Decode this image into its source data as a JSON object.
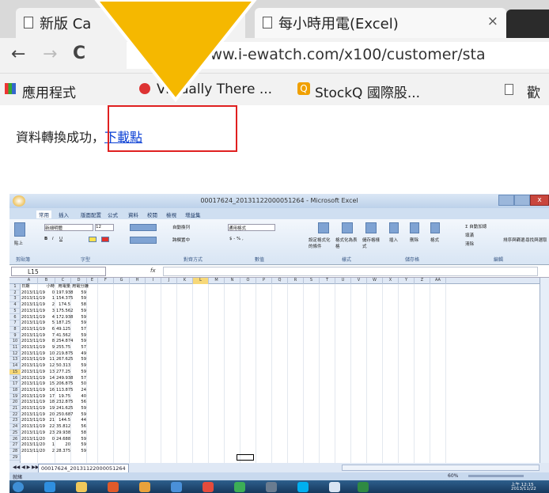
{
  "browser": {
    "tabs": [
      {
        "label": "新版 Ca",
        "active": false
      },
      {
        "label": "每小時用電(Excel)",
        "active": true
      }
    ],
    "address": "www.i-ewatch.com/x100/customer/sta",
    "bookmarks": [
      "應用程式",
      "Virtually There ...",
      "StockQ 國際股...",
      "歡"
    ]
  },
  "page": {
    "message": "資料轉換成功，",
    "download_link": "下載點"
  },
  "excel": {
    "window_title": "00017624_20131122000051264 - Microsoft Excel",
    "menu": [
      "常用",
      "插入",
      "版面配置",
      "公式",
      "資料",
      "校閱",
      "檢視",
      "增益集"
    ],
    "ribbon": {
      "font_name": "新細明體",
      "font_size": "12",
      "wrap_text": "自動換列",
      "number_format": "通用格式",
      "merge_center": "跨欄置中",
      "paste": "貼上",
      "insert": "插入",
      "delete": "刪除",
      "format": "格式",
      "autosum": "自動加總",
      "fill": "填滿",
      "clear": "清除",
      "sort_filter": "排序與篩選",
      "find_select": "尋找與選取",
      "conditional_format": "設定格式化的條件",
      "format_as_table": "格式化為表格",
      "cell_styles": "儲存格樣式",
      "groups": [
        "剪貼簿",
        "字型",
        "對齊方式",
        "數值",
        "樣式",
        "儲存格",
        "編輯"
      ]
    },
    "name_box": "L15",
    "formula_label": "fx",
    "columns": [
      "A",
      "B",
      "C",
      "D",
      "E",
      "F",
      "G",
      "H",
      "I",
      "J",
      "K",
      "L",
      "M",
      "N",
      "O",
      "P",
      "Q",
      "R",
      "S",
      "T",
      "U",
      "V",
      "W",
      "X",
      "Y",
      "Z",
      "AA"
    ],
    "headers": [
      "日期",
      "小時",
      "用電量",
      "用電分鐘"
    ],
    "rows": [
      [
        "2013/11/19",
        "0",
        "197.938",
        "59"
      ],
      [
        "2013/11/19",
        "1",
        "154.375",
        "59"
      ],
      [
        "2013/11/19",
        "2",
        "174.5",
        "58"
      ],
      [
        "2013/11/19",
        "3",
        "175.562",
        "59"
      ],
      [
        "2013/11/19",
        "4",
        "172.938",
        "59"
      ],
      [
        "2013/11/19",
        "5",
        "187.25",
        "59"
      ],
      [
        "2013/11/19",
        "6",
        "49.125",
        "57"
      ],
      [
        "2013/11/19",
        "7",
        "41.562",
        "59"
      ],
      [
        "2013/11/19",
        "8",
        "254.874",
        "59"
      ],
      [
        "2013/11/19",
        "9",
        "255.75",
        "57"
      ],
      [
        "2013/11/19",
        "10",
        "219.875",
        "49"
      ],
      [
        "2013/11/19",
        "11",
        "267.625",
        "59"
      ],
      [
        "2013/11/19",
        "12",
        "50.313",
        "59"
      ],
      [
        "2013/11/19",
        "13",
        "277.25",
        "59"
      ],
      [
        "2013/11/19",
        "14",
        "249.938",
        "57"
      ],
      [
        "2013/11/19",
        "15",
        "206.875",
        "50"
      ],
      [
        "2013/11/19",
        "16",
        "113.875",
        "24"
      ],
      [
        "2013/11/19",
        "17",
        "19.75",
        "40"
      ],
      [
        "2013/11/19",
        "18",
        "232.875",
        "56"
      ],
      [
        "2013/11/19",
        "19",
        "241.625",
        "59"
      ],
      [
        "2013/11/19",
        "20",
        "250.687",
        "59"
      ],
      [
        "2013/11/19",
        "21",
        "144.5",
        "44"
      ],
      [
        "2013/11/19",
        "22",
        "35.812",
        "56"
      ],
      [
        "2013/11/19",
        "23",
        "29.938",
        "58"
      ],
      [
        "2013/11/20",
        "0",
        "24.688",
        "59"
      ],
      [
        "2013/11/20",
        "1",
        "20",
        "59"
      ],
      [
        "2013/11/20",
        "2",
        "28.375",
        "59"
      ]
    ],
    "sheet_tab": "00017624_20131122000051264",
    "status": "就緒",
    "zoom": "60%",
    "clock_time": "上午 12:15",
    "clock_date": "2013/11/22"
  },
  "colors": {
    "arrow": "#f5b800",
    "highlight_box": "#e02020",
    "link": "#0a3fd4"
  }
}
